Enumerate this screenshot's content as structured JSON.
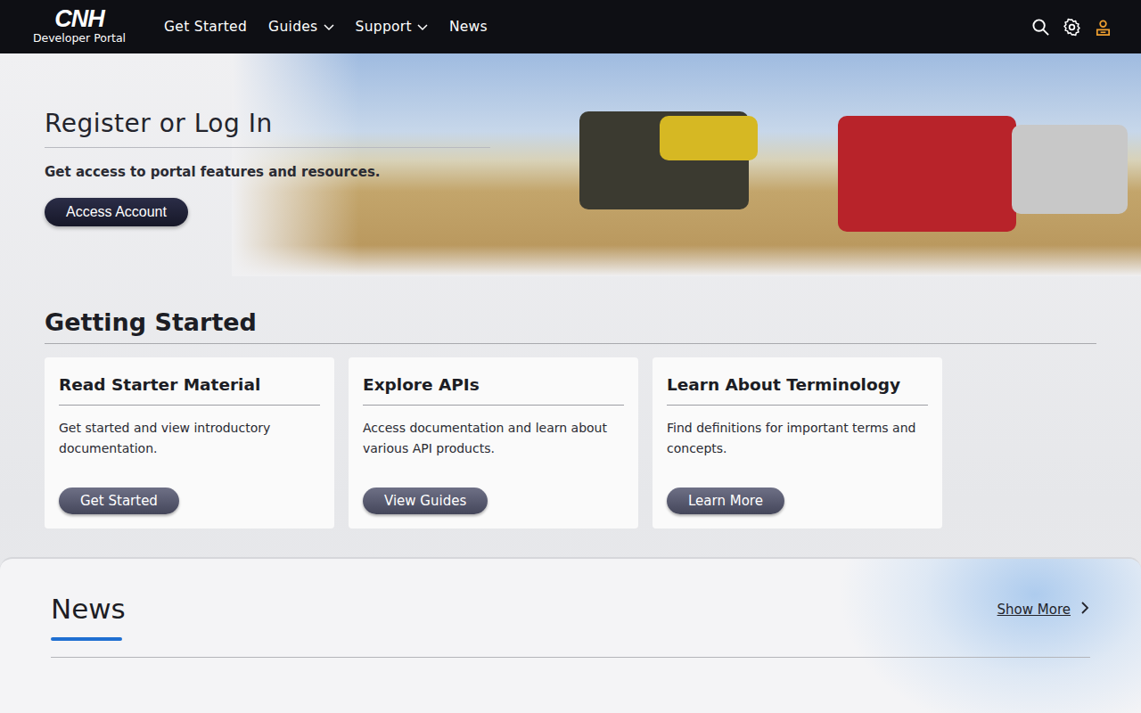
{
  "header": {
    "logo": "CNH",
    "subtitle": "Developer Portal",
    "nav": [
      {
        "label": "Get Started",
        "dropdown": false
      },
      {
        "label": "Guides",
        "dropdown": true
      },
      {
        "label": "Support",
        "dropdown": true
      },
      {
        "label": "News",
        "dropdown": false
      }
    ]
  },
  "hero": {
    "title": "Register or Log In",
    "text": "Get access to portal features and resources.",
    "button": "Access Account"
  },
  "getting_started": {
    "title": "Getting Started",
    "cards": [
      {
        "title": "Read Starter Material",
        "text": "Get started and view introductory documentation.",
        "button": "Get Started"
      },
      {
        "title": "Explore APIs",
        "text": "Access documentation and learn about various API products.",
        "button": "View Guides"
      },
      {
        "title": "Learn About Terminology",
        "text": "Find definitions for important terms and concepts.",
        "button": "Learn More"
      }
    ]
  },
  "news": {
    "title": "News",
    "show_more": "Show More"
  }
}
